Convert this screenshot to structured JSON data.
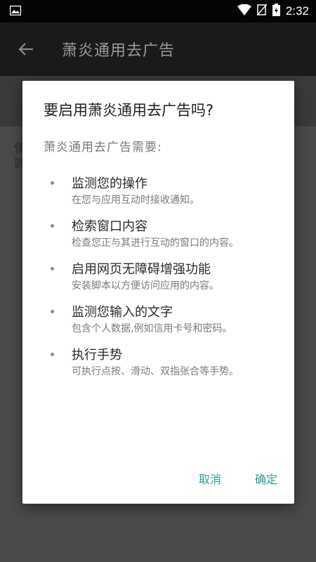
{
  "status_bar": {
    "time": "2:32",
    "icons": [
      "image-icon",
      "wifi-icon",
      "no-signal-icon",
      "battery-icon"
    ]
  },
  "app_bar": {
    "title": "萧炎通用去广告",
    "back_icon": "back-arrow-icon"
  },
  "background": {
    "text_line1": "使",
    "text_line2": "则"
  },
  "dialog": {
    "title": "要启用萧炎通用去广告吗?",
    "subtitle": "萧炎通用去广告需要:",
    "permissions": [
      {
        "title": "监测您的操作",
        "desc": "在您与应用互动时接收通知。"
      },
      {
        "title": "检索窗口内容",
        "desc": "检查您正与其进行互动的窗口的内容。"
      },
      {
        "title": "启用网页无障碍增强功能",
        "desc": "安装脚本以方便访问应用的内容。"
      },
      {
        "title": "监测您输入的文字",
        "desc": "包含个人数据,例如信用卡号和密码。"
      },
      {
        "title": "执行手势",
        "desc": "可执行点按、滑动、双指张合等手势。"
      }
    ],
    "cancel_label": "取消",
    "ok_label": "确定"
  },
  "colors": {
    "accent": "#2a9d94",
    "status_bar_bg": "#050505",
    "app_bar_bg": "#1a1a1a",
    "scrim": "#4a4a4a"
  }
}
